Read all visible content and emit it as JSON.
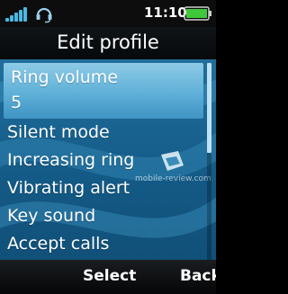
{
  "status_bar": {
    "time": "11:10",
    "signal_icon": "signal-strength-icon",
    "headset_icon": "headset-icon",
    "battery_icon": "battery-full-icon",
    "battery_color": "#3fc83a",
    "signal_color": "#4ab8e2"
  },
  "header": {
    "title": "Edit profile"
  },
  "menu": {
    "selected": {
      "label": "Ring volume",
      "value": "5"
    },
    "items": [
      {
        "label": "Silent mode"
      },
      {
        "label": "Increasing ring"
      },
      {
        "label": "Vibrating alert"
      },
      {
        "label": "Key sound"
      },
      {
        "label": "Accept calls"
      }
    ]
  },
  "watermark": {
    "text": "mobile-review.com"
  },
  "softkeys": {
    "center": "Select",
    "right": "Back"
  },
  "colors": {
    "accent": "#5fb0d8",
    "background": "#1d6a99"
  }
}
